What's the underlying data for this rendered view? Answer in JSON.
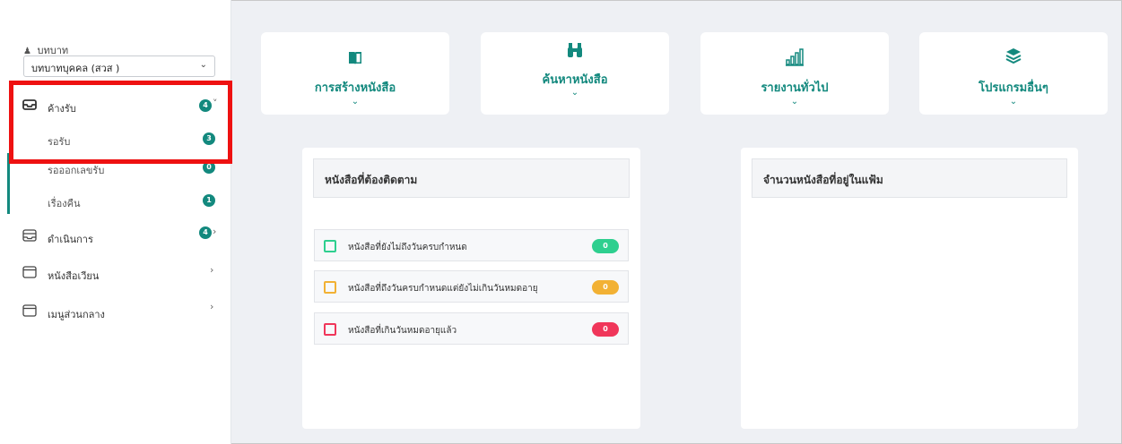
{
  "sidebar": {
    "role_label": "บทบาท",
    "role_value": "บทบาทบุคคล (สวส )",
    "menu": [
      {
        "label": "ค้างรับ",
        "icon": "inbox-icon",
        "badge": "4",
        "arrow": "˅"
      },
      {
        "label": "รอรับ",
        "badge": "3"
      },
      {
        "label": "รอออกเลขรับ",
        "badge": "0"
      },
      {
        "label": "เรื่องคืน",
        "badge": "1"
      },
      {
        "label": "ดำเนินการ",
        "icon": "inbox-stack-icon",
        "badge": "4",
        "arrow": "›"
      },
      {
        "label": "หนังสือเวียน",
        "icon": "window-icon",
        "arrow": "›"
      },
      {
        "label": "เมนูส่วนกลาง",
        "icon": "window-icon",
        "arrow": "›"
      }
    ]
  },
  "top_cards": [
    {
      "label": "การสร้างหนังสือ",
      "icon": "book-icon"
    },
    {
      "label": "ค้นหาหนังสือ",
      "icon": "binoculars-icon"
    },
    {
      "label": "รายงานทั่วไป",
      "icon": "bar-chart-icon"
    },
    {
      "label": "โปรแกรมอื่นๆ",
      "icon": "layers-icon"
    }
  ],
  "follow_panel": {
    "title": "หนังสือที่ต้องติดตาม",
    "rows": [
      {
        "label": "หนังสือที่ยังไม่ถึงวันครบกำหนด",
        "count": "0",
        "color": "#2ecf8f"
      },
      {
        "label": "หนังสือที่ถึงวันครบกำหนดแต่ยังไม่เกินวันหมดอายุ",
        "count": "0",
        "color": "#f2b134"
      },
      {
        "label": "หนังสือที่เกินวันหมดอายุแล้ว",
        "count": "0",
        "color": "#f0365a"
      }
    ]
  },
  "folder_panel": {
    "title": "จำนวนหนังสือที่อยู่ในแฟ้ม"
  },
  "colors": {
    "accent": "#13897e",
    "highlight": "#ee1111"
  }
}
